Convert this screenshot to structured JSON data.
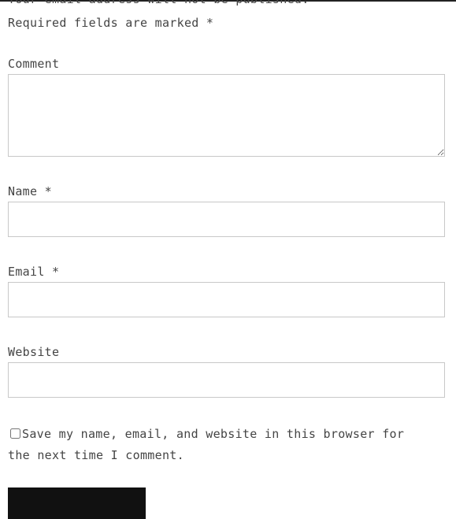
{
  "form": {
    "notes_partial": "Your email address will not be published.",
    "required_note": "Required fields are marked *",
    "comment": {
      "label": "Comment",
      "value": ""
    },
    "name": {
      "label": "Name *",
      "value": ""
    },
    "email": {
      "label": "Email *",
      "value": ""
    },
    "website": {
      "label": "Website",
      "value": ""
    },
    "consent": {
      "label": "Save my name, email, and website in this browser for the next time I comment.",
      "checked": false
    },
    "submit_label": ""
  },
  "colors": {
    "text": "#444444",
    "field_border": "#c8c8c8",
    "submit_background": "#111111"
  }
}
